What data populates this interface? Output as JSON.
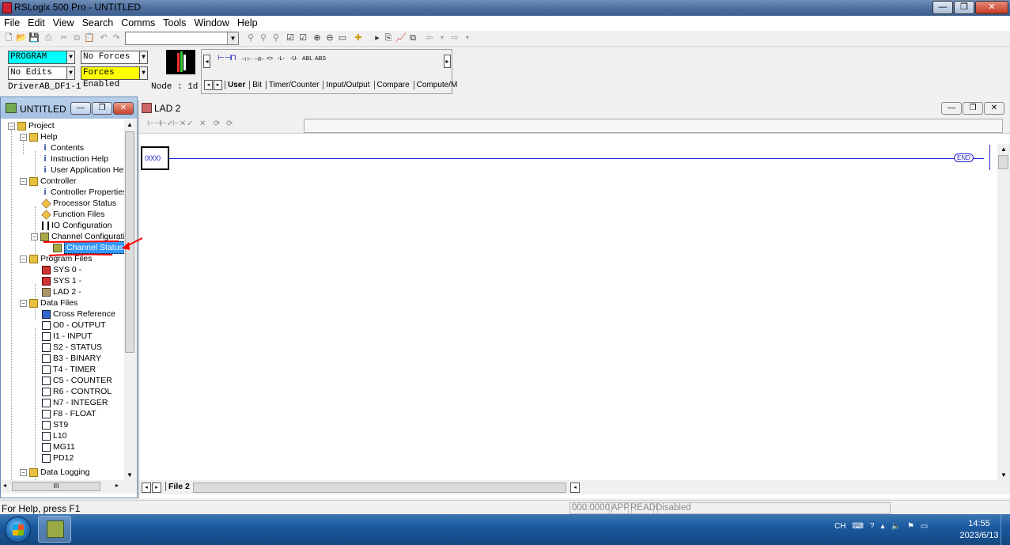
{
  "app": {
    "title": "RSLogix 500 Pro - UNTITLED"
  },
  "menu": [
    "File",
    "Edit",
    "View",
    "Search",
    "Comms",
    "Tools",
    "Window",
    "Help"
  ],
  "status_panel": {
    "mode": "PROGRAM",
    "forces": "No Forces",
    "edits": "No Edits",
    "forces_enabled": "Forces Enabled",
    "driver": "DriverAB_DF1-1",
    "node": "Node : 1d"
  },
  "instruction_tabs": [
    "User",
    "Bit",
    "Timer/Counter",
    "Input/Output",
    "Compare",
    "Compute/M"
  ],
  "tree_window": {
    "title": "UNTITLED",
    "nodes": [
      {
        "label": "Project"
      },
      {
        "label": "Help"
      },
      {
        "label": "Contents"
      },
      {
        "label": "Instruction Help"
      },
      {
        "label": "User Application Help"
      },
      {
        "label": "Controller"
      },
      {
        "label": "Controller Properties"
      },
      {
        "label": "Processor Status"
      },
      {
        "label": "Function Files"
      },
      {
        "label": "IO Configuration"
      },
      {
        "label": "Channel Configuration"
      },
      {
        "label": "Channel Status"
      },
      {
        "label": "Program Files"
      },
      {
        "label": "SYS 0 -"
      },
      {
        "label": "SYS 1 -"
      },
      {
        "label": "LAD 2 -"
      },
      {
        "label": "Data Files"
      },
      {
        "label": "Cross Reference"
      },
      {
        "label": "O0 - OUTPUT"
      },
      {
        "label": "I1 - INPUT"
      },
      {
        "label": "S2 - STATUS"
      },
      {
        "label": "B3 - BINARY"
      },
      {
        "label": "T4 - TIMER"
      },
      {
        "label": "C5 - COUNTER"
      },
      {
        "label": "R6 - CONTROL"
      },
      {
        "label": "N7 - INTEGER"
      },
      {
        "label": "F8 - FLOAT"
      },
      {
        "label": "ST9"
      },
      {
        "label": "L10"
      },
      {
        "label": "MG11"
      },
      {
        "label": "PD12"
      },
      {
        "label": "Data Logging"
      }
    ],
    "selected": "Channel Status"
  },
  "ladder_window": {
    "title": "LAD 2",
    "rung_number": "0000",
    "end_label": "END",
    "file_tab": "File 2"
  },
  "statusbar": {
    "help": "For Help, press F1",
    "address": "000:0000",
    "mode": "APP",
    "access": "READ",
    "state": "Disabled"
  },
  "taskbar": {
    "lang": "CH",
    "time": "14:55",
    "date": "2023/6/13"
  },
  "colors": {
    "ladder_blue": "#2222cc",
    "mode_cyan": "#00ffff",
    "forces_yellow": "#ffff00",
    "annotation_red": "#ff0000"
  }
}
